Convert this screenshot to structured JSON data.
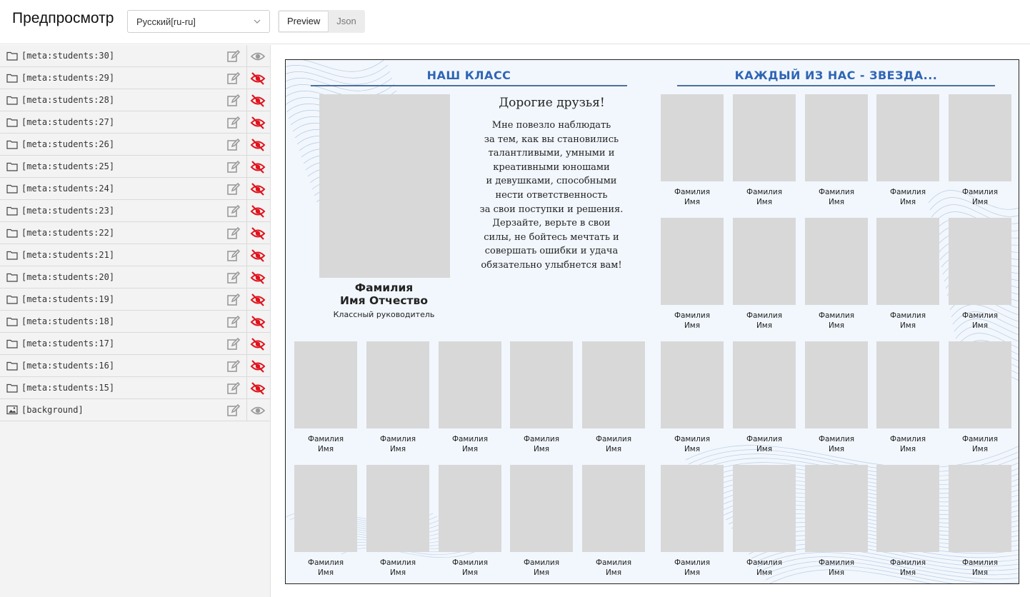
{
  "header": {
    "title": "Предпросмотр",
    "language": "Русский[ru-ru]",
    "tabs": [
      {
        "label": "Preview",
        "active": true
      },
      {
        "label": "Json",
        "active": false
      }
    ]
  },
  "sidebar": {
    "layers": [
      {
        "label": "[meta:students:30]",
        "icon": "folder-icon",
        "visible": true
      },
      {
        "label": "[meta:students:29]",
        "icon": "folder-icon",
        "visible": false
      },
      {
        "label": "[meta:students:28]",
        "icon": "folder-icon",
        "visible": false
      },
      {
        "label": "[meta:students:27]",
        "icon": "folder-icon",
        "visible": false
      },
      {
        "label": "[meta:students:26]",
        "icon": "folder-icon",
        "visible": false
      },
      {
        "label": "[meta:students:25]",
        "icon": "folder-icon",
        "visible": false
      },
      {
        "label": "[meta:students:24]",
        "icon": "folder-icon",
        "visible": false
      },
      {
        "label": "[meta:students:23]",
        "icon": "folder-icon",
        "visible": false
      },
      {
        "label": "[meta:students:22]",
        "icon": "folder-icon",
        "visible": false
      },
      {
        "label": "[meta:students:21]",
        "icon": "folder-icon",
        "visible": false
      },
      {
        "label": "[meta:students:20]",
        "icon": "folder-icon",
        "visible": false
      },
      {
        "label": "[meta:students:19]",
        "icon": "folder-icon",
        "visible": false
      },
      {
        "label": "[meta:students:18]",
        "icon": "folder-icon",
        "visible": false
      },
      {
        "label": "[meta:students:17]",
        "icon": "folder-icon",
        "visible": false
      },
      {
        "label": "[meta:students:16]",
        "icon": "folder-icon",
        "visible": false
      },
      {
        "label": "[meta:students:15]",
        "icon": "folder-icon",
        "visible": false
      },
      {
        "label": "[background]",
        "icon": "image-icon",
        "visible": true
      }
    ]
  },
  "poster": {
    "title_left": "НАШ КЛАСС",
    "title_right": "КАЖДЫЙ ИЗ НАС - ЗВЕЗДА...",
    "teacher_name": "Фамилия\nИмя Отчество",
    "teacher_role": "Классный руководитель",
    "greeting_title": "Дорогие друзья!",
    "greeting_text": "Мне повезло наблюдать\nза тем, как вы становились\nталантливыми, умными и\nкреативными юношами\nи девушками, способными\nнести ответственность\nза свои поступки и решения.\nДерзайте, верьте в свои\nсилы, не бойтесь мечтать и\nсовершать ошибки и удача\nобязательно улыбнется вам!",
    "student_caption": "Фамилия\nИмя",
    "student_count": 30
  },
  "colors": {
    "accent_title": "#2f65b5",
    "hidden_eye": "#e0141e",
    "visible_eye": "#9a9a9a",
    "photo_placeholder": "#d8d8d8"
  }
}
